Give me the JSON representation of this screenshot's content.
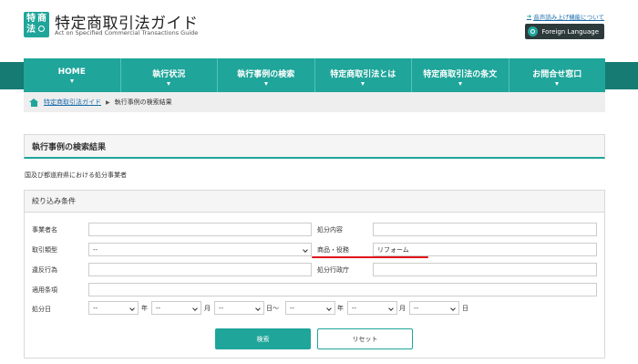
{
  "header": {
    "logo_chars": [
      "特",
      "商",
      "法"
    ],
    "title": "特定商取引法ガイド",
    "subtitle": "Act on Specified Commercial Transactions Guide",
    "accessibility_link": "音声読み上げ機能について",
    "foreign_language": "Foreign Language"
  },
  "nav": {
    "items": [
      "HOME",
      "執行状況",
      "執行事例の検索",
      "特定商取引法とは",
      "特定商取引法の条文",
      "お問合せ窓口"
    ]
  },
  "breadcrumb": {
    "home": "特定商取引法ガイド",
    "separator": "▶",
    "current": "執行事例の検索結果"
  },
  "page": {
    "title": "執行事例の検索結果",
    "description": "国及び都道府県における処分事業者"
  },
  "filter": {
    "title": "絞り込み条件",
    "labels": {
      "business_name": "事業者名",
      "transaction_type": "取引類型",
      "violation": "違反行為",
      "applicable_article": "適用条項",
      "disposition_date": "処分日",
      "disposition_content": "処分内容",
      "product_service": "商品・役務",
      "disposition_agency": "処分行政庁"
    },
    "values": {
      "business_name": "",
      "transaction_type": "--",
      "violation": "",
      "applicable_article": "",
      "disposition_content": "",
      "product_service": "リフォーム",
      "disposition_agency": ""
    },
    "date": {
      "from_year": "--",
      "from_month": "--",
      "from_day": "--",
      "to_year": "--",
      "to_month": "--",
      "to_day": "--",
      "year_unit": "年",
      "month_unit": "月",
      "day_unit": "日",
      "range_sep": "日～"
    },
    "search_button": "検索",
    "reset_button": "リセット"
  },
  "colors": {
    "accent": "#1fa59a",
    "nav_band": "#167b72",
    "highlight": "#e0151b"
  }
}
